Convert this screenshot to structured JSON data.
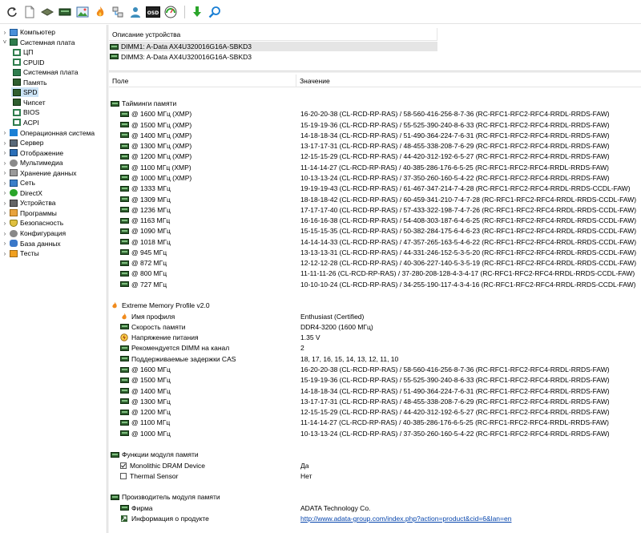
{
  "tree": [
    {
      "label": "Компьютер",
      "level": 0,
      "expander": "›",
      "icon": "computer-icon"
    },
    {
      "label": "Системная плата",
      "level": 0,
      "expander": "˅",
      "icon": "motherboard-icon"
    },
    {
      "label": "ЦП",
      "level": 1,
      "expander": "",
      "icon": "cpu-icon"
    },
    {
      "label": "CPUID",
      "level": 1,
      "expander": "",
      "icon": "cpuid-icon"
    },
    {
      "label": "Системная плата",
      "level": 1,
      "expander": "",
      "icon": "motherboard-icon"
    },
    {
      "label": "Память",
      "level": 1,
      "expander": "",
      "icon": "memory-icon"
    },
    {
      "label": "SPD",
      "level": 1,
      "expander": "",
      "icon": "spd-icon",
      "selected": true
    },
    {
      "label": "Чипсет",
      "level": 1,
      "expander": "",
      "icon": "chipset-icon"
    },
    {
      "label": "BIOS",
      "level": 1,
      "expander": "",
      "icon": "bios-icon"
    },
    {
      "label": "ACPI",
      "level": 1,
      "expander": "",
      "icon": "acpi-icon"
    },
    {
      "label": "Операционная система",
      "level": 0,
      "expander": "›",
      "icon": "windows-icon"
    },
    {
      "label": "Сервер",
      "level": 0,
      "expander": "›",
      "icon": "server-icon"
    },
    {
      "label": "Отображение",
      "level": 0,
      "expander": "›",
      "icon": "display-icon"
    },
    {
      "label": "Мультимедиа",
      "level": 0,
      "expander": "›",
      "icon": "multimedia-icon"
    },
    {
      "label": "Хранение данных",
      "level": 0,
      "expander": "›",
      "icon": "storage-icon"
    },
    {
      "label": "Сеть",
      "level": 0,
      "expander": "›",
      "icon": "network-icon"
    },
    {
      "label": "DirectX",
      "level": 0,
      "expander": "›",
      "icon": "directx-icon"
    },
    {
      "label": "Устройства",
      "level": 0,
      "expander": "›",
      "icon": "devices-icon"
    },
    {
      "label": "Программы",
      "level": 0,
      "expander": "›",
      "icon": "programs-icon"
    },
    {
      "label": "Безопасность",
      "level": 0,
      "expander": "›",
      "icon": "security-icon"
    },
    {
      "label": "Конфигурация",
      "level": 0,
      "expander": "›",
      "icon": "config-icon"
    },
    {
      "label": "База данных",
      "level": 0,
      "expander": "›",
      "icon": "database-icon"
    },
    {
      "label": "Тесты",
      "level": 0,
      "expander": "›",
      "icon": "tests-icon"
    }
  ],
  "device_panel": {
    "header": "Описание устройства",
    "devices": [
      "DIMM1: A-Data AX4U320016G16A-SBKD3",
      "DIMM3: A-Data AX4U320016G16A-SBKD3"
    ]
  },
  "columns": {
    "field": "Поле",
    "value": "Значение"
  },
  "rows": [
    {
      "type": "section",
      "label": "Тайминги памяти",
      "icon": "ram"
    },
    {
      "type": "item",
      "label": "@ 1600 МГц (XMP)",
      "value": "16-20-20-38  (CL-RCD-RP-RAS) / 58-560-416-256-8-7-36  (RC-RFC1-RFC2-RFC4-RRDL-RRDS-FAW)",
      "icon": "ram"
    },
    {
      "type": "item",
      "label": "@ 1500 МГц (XMP)",
      "value": "15-19-19-36  (CL-RCD-RP-RAS) / 55-525-390-240-8-6-33  (RC-RFC1-RFC2-RFC4-RRDL-RRDS-FAW)",
      "icon": "ram"
    },
    {
      "type": "item",
      "label": "@ 1400 МГц (XMP)",
      "value": "14-18-18-34  (CL-RCD-RP-RAS) / 51-490-364-224-7-6-31  (RC-RFC1-RFC2-RFC4-RRDL-RRDS-FAW)",
      "icon": "ram"
    },
    {
      "type": "item",
      "label": "@ 1300 МГц (XMP)",
      "value": "13-17-17-31  (CL-RCD-RP-RAS) / 48-455-338-208-7-6-29  (RC-RFC1-RFC2-RFC4-RRDL-RRDS-FAW)",
      "icon": "ram"
    },
    {
      "type": "item",
      "label": "@ 1200 МГц (XMP)",
      "value": "12-15-15-29  (CL-RCD-RP-RAS) / 44-420-312-192-6-5-27  (RC-RFC1-RFC2-RFC4-RRDL-RRDS-FAW)",
      "icon": "ram"
    },
    {
      "type": "item",
      "label": "@ 1100 МГц (XMP)",
      "value": "11-14-14-27  (CL-RCD-RP-RAS) / 40-385-286-176-6-5-25  (RC-RFC1-RFC2-RFC4-RRDL-RRDS-FAW)",
      "icon": "ram"
    },
    {
      "type": "item",
      "label": "@ 1000 МГц (XMP)",
      "value": "10-13-13-24  (CL-RCD-RP-RAS) / 37-350-260-160-5-4-22  (RC-RFC1-RFC2-RFC4-RRDL-RRDS-FAW)",
      "icon": "ram"
    },
    {
      "type": "item",
      "label": "@ 1333 МГц",
      "value": "19-19-19-43  (CL-RCD-RP-RAS) / 61-467-347-214-7-4-28  (RC-RFC1-RFC2-RFC4-RRDL-RRDS-CCDL-FAW)",
      "icon": "ram"
    },
    {
      "type": "item",
      "label": "@ 1309 МГц",
      "value": "18-18-18-42  (CL-RCD-RP-RAS) / 60-459-341-210-7-4-7-28  (RC-RFC1-RFC2-RFC4-RRDL-RRDS-CCDL-FAW)",
      "icon": "ram"
    },
    {
      "type": "item",
      "label": "@ 1236 МГц",
      "value": "17-17-17-40  (CL-RCD-RP-RAS) / 57-433-322-198-7-4-7-26  (RC-RFC1-RFC2-RFC4-RRDL-RRDS-CCDL-FAW)",
      "icon": "ram"
    },
    {
      "type": "item",
      "label": "@ 1163 МГц",
      "value": "16-16-16-38  (CL-RCD-RP-RAS) / 54-408-303-187-6-4-6-25  (RC-RFC1-RFC2-RFC4-RRDL-RRDS-CCDL-FAW)",
      "icon": "ram"
    },
    {
      "type": "item",
      "label": "@ 1090 МГц",
      "value": "15-15-15-35  (CL-RCD-RP-RAS) / 50-382-284-175-6-4-6-23  (RC-RFC1-RFC2-RFC4-RRDL-RRDS-CCDL-FAW)",
      "icon": "ram"
    },
    {
      "type": "item",
      "label": "@ 1018 МГц",
      "value": "14-14-14-33  (CL-RCD-RP-RAS) / 47-357-265-163-5-4-6-22  (RC-RFC1-RFC2-RFC4-RRDL-RRDS-CCDL-FAW)",
      "icon": "ram"
    },
    {
      "type": "item",
      "label": "@ 945 МГц",
      "value": "13-13-13-31  (CL-RCD-RP-RAS) / 44-331-246-152-5-3-5-20  (RC-RFC1-RFC2-RFC4-RRDL-RRDS-CCDL-FAW)",
      "icon": "ram"
    },
    {
      "type": "item",
      "label": "@ 872 МГц",
      "value": "12-12-12-28  (CL-RCD-RP-RAS) / 40-306-227-140-5-3-5-19  (RC-RFC1-RFC2-RFC4-RRDL-RRDS-CCDL-FAW)",
      "icon": "ram"
    },
    {
      "type": "item",
      "label": "@ 800 МГц",
      "value": "11-11-11-26  (CL-RCD-RP-RAS) / 37-280-208-128-4-3-4-17  (RC-RFC1-RFC2-RFC4-RRDL-RRDS-CCDL-FAW)",
      "icon": "ram"
    },
    {
      "type": "item",
      "label": "@ 727 МГц",
      "value": "10-10-10-24  (CL-RCD-RP-RAS) / 34-255-190-117-4-3-4-16  (RC-RFC1-RFC2-RFC4-RRDL-RRDS-CCDL-FAW)",
      "icon": "ram"
    },
    {
      "type": "blank"
    },
    {
      "type": "section",
      "label": "Extreme Memory Profile v2.0",
      "icon": "flame"
    },
    {
      "type": "item",
      "label": "Имя профиля",
      "value": "Enthusiast (Certified)",
      "icon": "flame"
    },
    {
      "type": "item",
      "label": "Скорость памяти",
      "value": "DDR4-3200 (1600 МГц)",
      "icon": "ram"
    },
    {
      "type": "item",
      "label": "Напряжение питания",
      "value": "1.35 V",
      "icon": "voltage"
    },
    {
      "type": "item",
      "label": "Рекомендуется DIMM на канал",
      "value": "2",
      "icon": "ram"
    },
    {
      "type": "item",
      "label": "Поддерживаемые задержки CAS",
      "value": "18, 17, 16, 15, 14, 13, 12, 11, 10",
      "icon": "ram"
    },
    {
      "type": "item",
      "label": "@ 1600 МГц",
      "value": "16-20-20-38  (CL-RCD-RP-RAS) / 58-560-416-256-8-7-36  (RC-RFC1-RFC2-RFC4-RRDL-RRDS-FAW)",
      "icon": "ram"
    },
    {
      "type": "item",
      "label": "@ 1500 МГц",
      "value": "15-19-19-36  (CL-RCD-RP-RAS) / 55-525-390-240-8-6-33  (RC-RFC1-RFC2-RFC4-RRDL-RRDS-FAW)",
      "icon": "ram"
    },
    {
      "type": "item",
      "label": "@ 1400 МГц",
      "value": "14-18-18-34  (CL-RCD-RP-RAS) / 51-490-364-224-7-6-31  (RC-RFC1-RFC2-RFC4-RRDL-RRDS-FAW)",
      "icon": "ram"
    },
    {
      "type": "item",
      "label": "@ 1300 МГц",
      "value": "13-17-17-31  (CL-RCD-RP-RAS) / 48-455-338-208-7-6-29  (RC-RFC1-RFC2-RFC4-RRDL-RRDS-FAW)",
      "icon": "ram"
    },
    {
      "type": "item",
      "label": "@ 1200 МГц",
      "value": "12-15-15-29  (CL-RCD-RP-RAS) / 44-420-312-192-6-5-27  (RC-RFC1-RFC2-RFC4-RRDL-RRDS-FAW)",
      "icon": "ram"
    },
    {
      "type": "item",
      "label": "@ 1100 МГц",
      "value": "11-14-14-27  (CL-RCD-RP-RAS) / 40-385-286-176-6-5-25  (RC-RFC1-RFC2-RFC4-RRDL-RRDS-FAW)",
      "icon": "ram"
    },
    {
      "type": "item",
      "label": "@ 1000 МГц",
      "value": "10-13-13-24  (CL-RCD-RP-RAS) / 37-350-260-160-5-4-22  (RC-RFC1-RFC2-RFC4-RRDL-RRDS-FAW)",
      "icon": "ram"
    },
    {
      "type": "blank"
    },
    {
      "type": "section",
      "label": "Функции модуля памяти",
      "icon": "ram"
    },
    {
      "type": "item",
      "label": "Monolithic DRAM Device",
      "value": "Да",
      "icon": "checked"
    },
    {
      "type": "item",
      "label": "Thermal Sensor",
      "value": "Нет",
      "icon": "unchecked"
    },
    {
      "type": "blank"
    },
    {
      "type": "section",
      "label": "Производитель модуля памяти",
      "icon": "ram"
    },
    {
      "type": "item",
      "label": "Фирма",
      "value": "ADATA Technology Co.",
      "icon": "ram"
    },
    {
      "type": "item",
      "label": "Информация о продукте",
      "value": "http://www.adata-group.com/index.php?action=product&cid=6&lan=en",
      "icon": "link",
      "link": true
    }
  ],
  "colors": {
    "selection": "#cce4f7",
    "ram": "#2f5f2f",
    "link": "#0645ad",
    "accent": "#1a7fd4"
  }
}
